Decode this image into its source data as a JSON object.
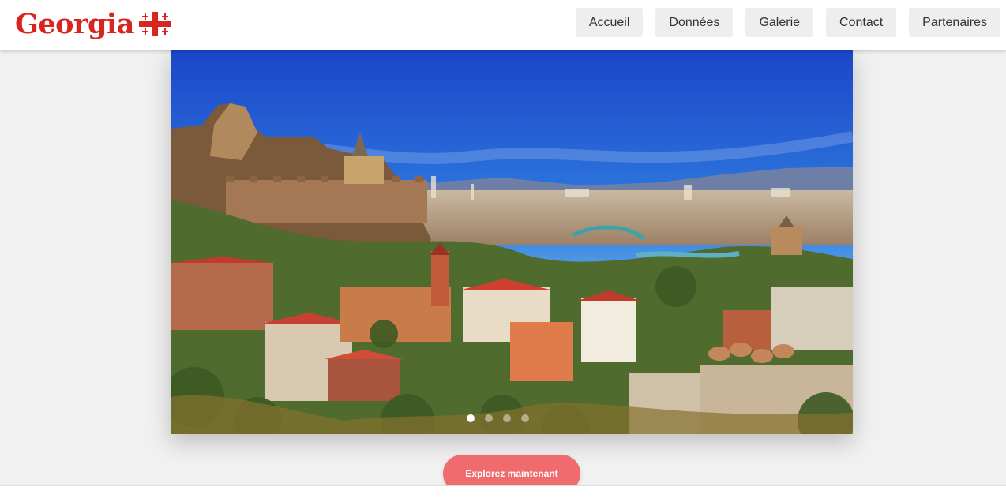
{
  "header": {
    "logo_text": "Georgia",
    "logo_icon": "georgian-flag-icon"
  },
  "nav": {
    "items": [
      {
        "label": "Accueil"
      },
      {
        "label": "Données"
      },
      {
        "label": "Galerie"
      },
      {
        "label": "Contact"
      },
      {
        "label": "Partenaires"
      }
    ]
  },
  "hero": {
    "image_subject": "Tbilisi old town panorama",
    "slides_count": 4,
    "active_slide": 1
  },
  "cta": {
    "label": "Explorez maintenant"
  },
  "colors": {
    "brand_red": "#d9251f",
    "cta_pink": "#f06b6e",
    "nav_bg": "#eeeeee",
    "page_bg": "#f1f1f1"
  }
}
